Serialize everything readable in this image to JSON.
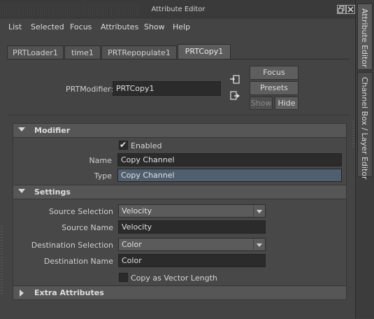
{
  "window": {
    "title": "Attribute Editor"
  },
  "menu": [
    "List",
    "Selected",
    "Focus",
    "Attributes",
    "Show",
    "Help"
  ],
  "tabs": [
    "PRTLoader1",
    "time1",
    "PRTRepopulate1",
    "PRTCopy1"
  ],
  "active_tab": "PRTCopy1",
  "node": {
    "label": "PRTModifier:",
    "value": "PRTCopy1"
  },
  "buttons": {
    "focus": "Focus",
    "presets": "Presets",
    "show": "Show",
    "hide": "Hide"
  },
  "modifier": {
    "title": "Modifier",
    "enabled_label": "Enabled",
    "enabled": true,
    "name_label": "Name",
    "name_value": "Copy Channel",
    "type_label": "Type",
    "type_value": "Copy Channel"
  },
  "settings": {
    "title": "Settings",
    "source_selection_label": "Source Selection",
    "source_selection_value": "Velocity",
    "source_name_label": "Source Name",
    "source_name_value": "Velocity",
    "dest_selection_label": "Destination Selection",
    "dest_selection_value": "Color",
    "dest_name_label": "Destination Name",
    "dest_name_value": "Color",
    "vector_length_label": "Copy as Vector Length",
    "vector_length": false
  },
  "extra": {
    "title": "Extra Attributes"
  },
  "sidebar": {
    "tab1": "Attribute Editor",
    "tab2": "Channel Box / Layer Editor"
  }
}
